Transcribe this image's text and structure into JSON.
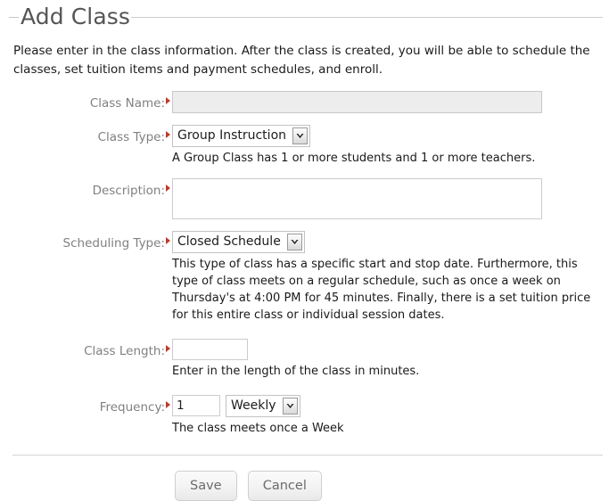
{
  "header": {
    "title": "Add Class"
  },
  "intro": {
    "text": "Please enter in the class information. After the class is created, you will be able to schedule the classes, set tuition items and payment schedules, and enroll."
  },
  "form": {
    "class_name": {
      "label": "Class Name:",
      "value": "",
      "placeholder": ""
    },
    "class_type": {
      "label": "Class Type:",
      "value": "Group Instruction",
      "help": "A Group Class has 1 or more students and 1 or more teachers."
    },
    "description": {
      "label": "Description:",
      "value": "",
      "placeholder": ""
    },
    "scheduling_type": {
      "label": "Scheduling Type:",
      "value": "Closed Schedule",
      "help": "This type of class has a specific start and stop date. Furthermore, this type of class meets on a regular schedule, such as once a week on Thursday's at 4:00 PM for 45 minutes. Finally, there is a set tuition price for this entire class or individual session dates."
    },
    "class_length": {
      "label": "Class Length:",
      "value": "",
      "placeholder": "",
      "help": "Enter in the length of the class in minutes."
    },
    "frequency": {
      "label": "Frequency:",
      "count_value": "1",
      "count_placeholder": "",
      "period_value": "Weekly",
      "help": "The class meets once a Week"
    }
  },
  "footer": {
    "save_label": "Save",
    "cancel_label": "Cancel"
  },
  "icons": {
    "required_marker": "required-triangle-icon",
    "dropdown": "chevron-down-icon"
  },
  "colors": {
    "required_marker": "#c0392b",
    "title": "#555555",
    "label": "#808080",
    "disabled_field": "#ededed"
  }
}
